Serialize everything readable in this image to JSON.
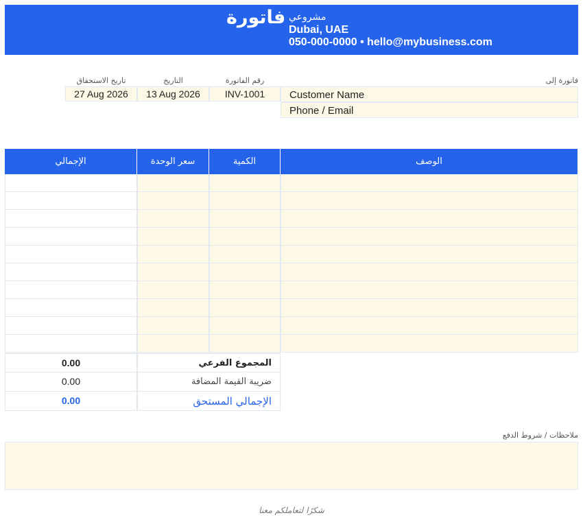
{
  "header": {
    "title": "فاتورة",
    "business_name": "مشروعي",
    "city": "Dubai, UAE",
    "contact": "050-000-0000  •  hello@mybusiness.com",
    "bg_color": "#2563eb"
  },
  "bill_to": {
    "label": "فاتورة إلى",
    "customer_name": "Customer Name",
    "phone_email": "Phone / Email"
  },
  "meta": {
    "invoice_number_label": "رقم الفاتورة",
    "invoice_number": "INV-1001",
    "date_label": "التاريخ",
    "date": "13 Aug 2026",
    "due_date_label": "تاريخ الاستحقاق",
    "due_date": "27 Aug 2026"
  },
  "items_table": {
    "columns": [
      "الوصف",
      "الكمية",
      "سعر الوحدة",
      "الإجمالي"
    ],
    "row_count": 10
  },
  "totals": {
    "subtotal_label": "المجموع الفرعي",
    "subtotal": "0.00",
    "vat_label": "ضريبة القيمة المضافة",
    "vat": "0.00",
    "grand_total_label": "الإجمالي المستحق",
    "grand_total": "0.00",
    "accent_color": "#2563eb"
  },
  "notes": {
    "label": "ملاحظات / شروط الدفع"
  },
  "footer": {
    "thanks": "شكرًا لتعاملكم معنا"
  }
}
